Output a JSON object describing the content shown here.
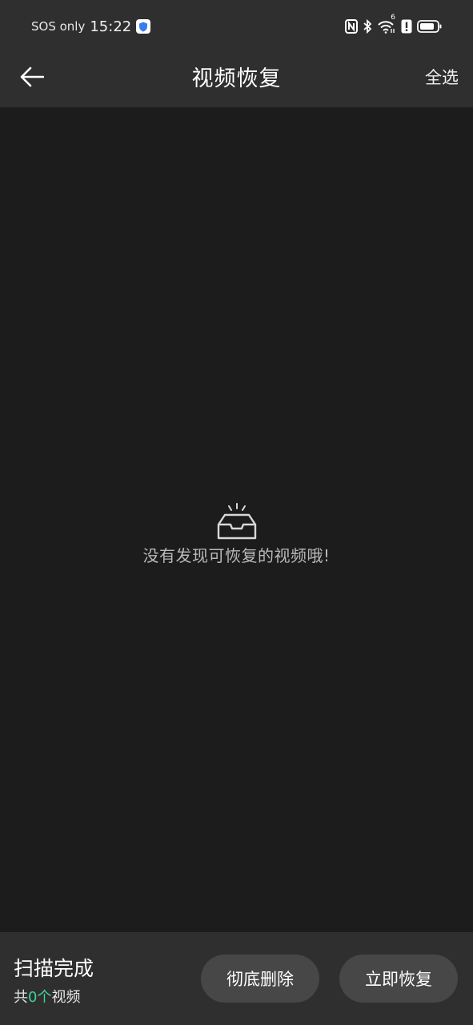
{
  "status_bar": {
    "carrier": "SOS only",
    "time": "15:22",
    "icons": [
      "shield-icon",
      "nfc-icon",
      "bluetooth-icon",
      "wifi-icon",
      "alert-icon",
      "battery-icon"
    ],
    "wifi_badge": "6"
  },
  "app_bar": {
    "title": "视频恢复",
    "select_all": "全选",
    "back_icon": "back-arrow-icon"
  },
  "empty_state": {
    "icon": "empty-tray-icon",
    "message": "没有发现可恢复的视频哦!"
  },
  "bottom_bar": {
    "scan_status": "扫描完成",
    "count_prefix": "共",
    "count_value": "0",
    "count_unit": "个",
    "count_suffix": "视频",
    "delete_button": "彻底删除",
    "restore_button": "立即恢复"
  },
  "colors": {
    "background": "#1c1c1c",
    "bars": "#2f2f2f",
    "button": "#474747",
    "accent_count": "#3fd39a",
    "muted_text": "#b9b9b9"
  }
}
